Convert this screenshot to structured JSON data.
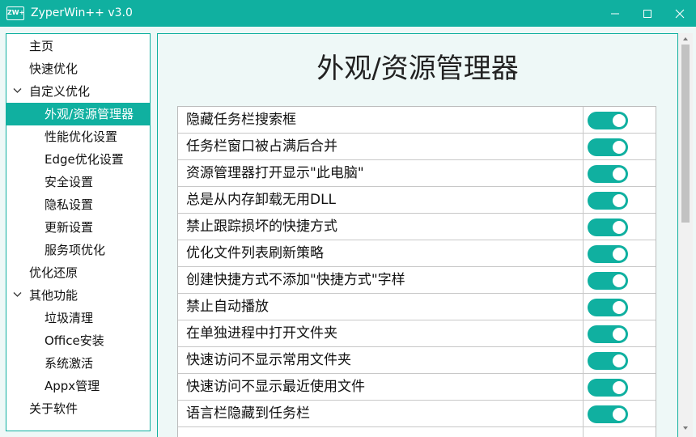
{
  "window": {
    "icon_text": "ZW+",
    "title": "ZyperWin++ v3.0",
    "accent_color": "#10b0a0"
  },
  "sidebar": {
    "items": [
      {
        "label": "主页",
        "level": 0
      },
      {
        "label": "快速优化",
        "level": 0
      },
      {
        "label": "自定义优化",
        "level": 0,
        "expanded": true
      },
      {
        "label": "外观/资源管理器",
        "level": 1,
        "selected": true
      },
      {
        "label": "性能优化设置",
        "level": 1
      },
      {
        "label": "Edge优化设置",
        "level": 1
      },
      {
        "label": "安全设置",
        "level": 1
      },
      {
        "label": "隐私设置",
        "level": 1
      },
      {
        "label": "更新设置",
        "level": 1
      },
      {
        "label": "服务项优化",
        "level": 1
      },
      {
        "label": "优化还原",
        "level": 0
      },
      {
        "label": "其他功能",
        "level": 0,
        "expanded": true
      },
      {
        "label": "垃圾清理",
        "level": 1
      },
      {
        "label": "Office安装",
        "level": 1
      },
      {
        "label": "系统激活",
        "level": 1
      },
      {
        "label": "Appx管理",
        "level": 1
      },
      {
        "label": "关于软件",
        "level": 0
      }
    ]
  },
  "main": {
    "title": "外观/资源管理器",
    "settings": [
      {
        "label": "隐藏任务栏搜索框",
        "enabled": true
      },
      {
        "label": "任务栏窗口被占满后合并",
        "enabled": true
      },
      {
        "label": "资源管理器打开显示\"此电脑\"",
        "enabled": true
      },
      {
        "label": "总是从内存卸载无用DLL",
        "enabled": true
      },
      {
        "label": "禁止跟踪损坏的快捷方式",
        "enabled": true
      },
      {
        "label": "优化文件列表刷新策略",
        "enabled": true
      },
      {
        "label": "创建快捷方式不添加\"快捷方式\"字样",
        "enabled": true
      },
      {
        "label": "禁止自动播放",
        "enabled": true
      },
      {
        "label": "在单独进程中打开文件夹",
        "enabled": true
      },
      {
        "label": "快速访问不显示常用文件夹",
        "enabled": true
      },
      {
        "label": "快速访问不显示最近使用文件",
        "enabled": true
      },
      {
        "label": "语言栏隐藏到任务栏",
        "enabled": true
      }
    ]
  }
}
